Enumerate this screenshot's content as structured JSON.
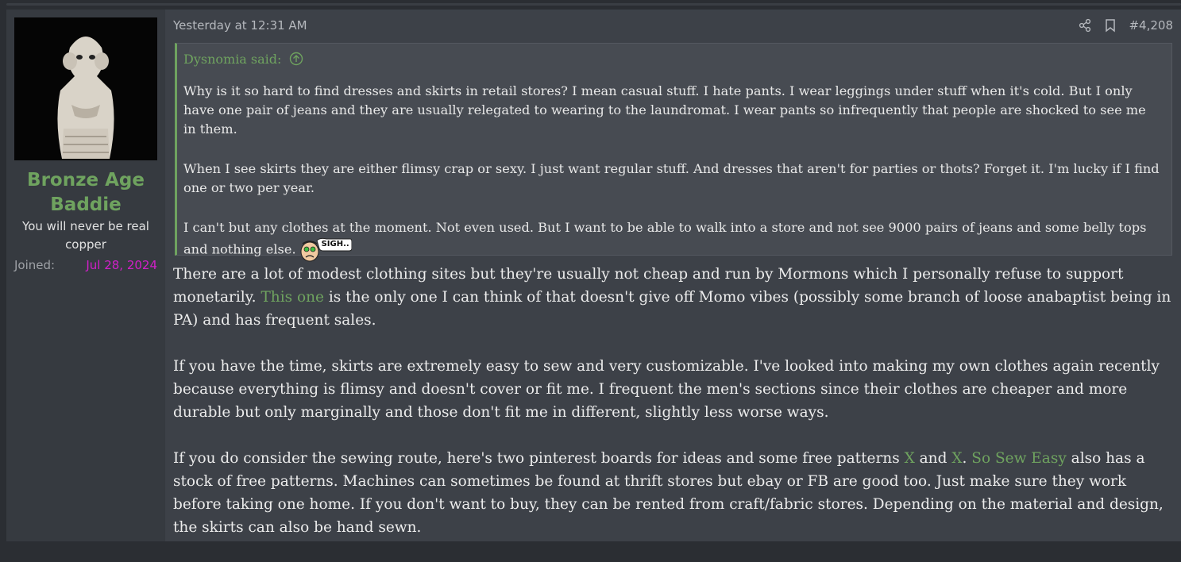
{
  "post": {
    "timestamp": "Yesterday at 12:31 AM",
    "post_number": "#4,208",
    "share_icon": "share-icon",
    "bookmark_icon": "bookmark-icon"
  },
  "user": {
    "name": "Bronze Age Baddie",
    "title": "You will never be real copper",
    "joined_label": "Joined:",
    "joined_date": "Jul 28, 2024"
  },
  "quote": {
    "author": "Dysnomia said:",
    "paragraphs": [
      "Why is it so hard to find dresses and skirts in retail stores? I mean casual stuff. I hate pants. I wear leggings under stuff when it's cold. But I only have one pair of jeans and they are usually relegated to wearing to the laundromat. I wear pants so infrequently that people are shocked to see me in them.",
      "When I see skirts they are either flimsy crap or sexy. I just want regular stuff. And dresses that aren't for parties or thots? Forget it. I'm lucky if I find one or two per year.",
      "I can't but any clothes at the moment. Not even used. But I want to be able to walk into a store and not see 9000 pairs of jeans and some belly tops and nothing else."
    ],
    "emoji_text": "SIGH.."
  },
  "body": {
    "p1_a": "There are a lot of modest clothing sites but they're usually not cheap and run by Mormons which I personally refuse to support monetarily. ",
    "p1_link": "This one",
    "p1_b": " is the only one I can think of that doesn't give off Momo vibes (possibly some branch of loose anabaptist being in PA) and has frequent sales.",
    "p2": "If you have the time, skirts are extremely easy to sew and very customizable. I've looked into making my own clothes again recently because everything is flimsy and doesn't cover or fit me. I frequent the men's sections since their clothes are cheaper and more durable but only marginally and those don't fit me in different, slightly less worse ways.",
    "p3_a": "If you do consider the sewing route, here's two pinterest boards for ideas and some free patterns ",
    "p3_link1": "X",
    "p3_and": " and ",
    "p3_link2": "X",
    "p3_dot": ". ",
    "p3_link3": "So Sew Easy",
    "p3_b": " also has a stock of free patterns. Machines can sometimes be found at thrift stores but ebay or FB are good too. Just make sure they work before taking one home. If you don't want to buy, they can be rented from craft/fabric stores. Depending on the material and design, the skirts can also be hand sewn."
  },
  "colors": {
    "accent": "#6fa35f",
    "joined_date": "#d21fc9",
    "panel": "#363a40",
    "content": "#3d4148"
  }
}
